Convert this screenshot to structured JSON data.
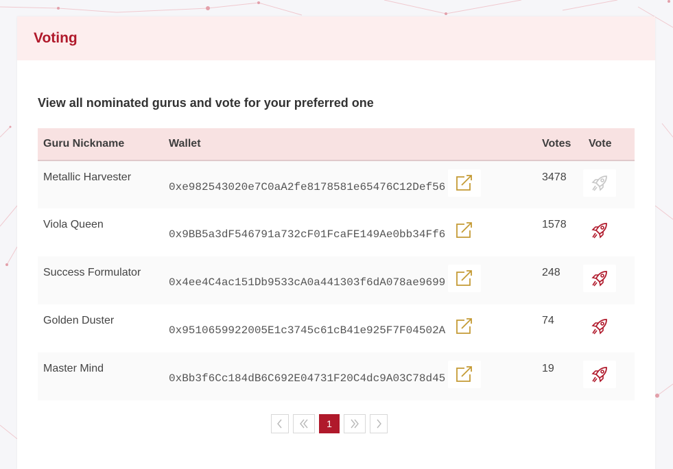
{
  "page": {
    "title": "Voting"
  },
  "intro": {
    "text": "View all nominated gurus and vote for your preferred one"
  },
  "table": {
    "headers": {
      "nickname": "Guru Nickname",
      "wallet": "Wallet",
      "votes": "Votes",
      "vote": "Vote"
    },
    "rows": [
      {
        "nickname": "Metallic Harvester",
        "wallet": "0xe982543020e7C0aA2fe8178581e65476C12Def56",
        "votes": "3478",
        "vote_enabled": false
      },
      {
        "nickname": "Viola Queen",
        "wallet": "0x9BB5a3dF546791a732cF01FcaFE149Ae0bb34Ff6",
        "votes": "1578",
        "vote_enabled": true
      },
      {
        "nickname": "Success Formulator",
        "wallet": "0x4ee4C4ac151Db9533cA0a441303f6dA078ae9699",
        "votes": "248",
        "vote_enabled": true
      },
      {
        "nickname": "Golden Duster",
        "wallet": "0x9510659922005E1c3745c61cB41e925F7F04502A",
        "votes": "74",
        "vote_enabled": true
      },
      {
        "nickname": "Master Mind",
        "wallet": "0xBb3f6Cc184dB6C692E04731F20C4dc9A03C78d45",
        "votes": "19",
        "vote_enabled": true
      }
    ]
  },
  "pagination": {
    "current_page": "1"
  },
  "icons": {
    "edit": "external-edit-icon",
    "vote": "rocket-icon",
    "prev": "chevron-left-icon",
    "first": "double-chevron-left-icon",
    "last": "double-chevron-right-icon",
    "next": "chevron-right-icon"
  },
  "colors": {
    "accent": "#b0192b",
    "header_bg": "#fdeeee",
    "table_header_bg": "#f8e2e2",
    "edit_icon": "#c49a34",
    "disabled_icon": "#c8c8c8"
  }
}
